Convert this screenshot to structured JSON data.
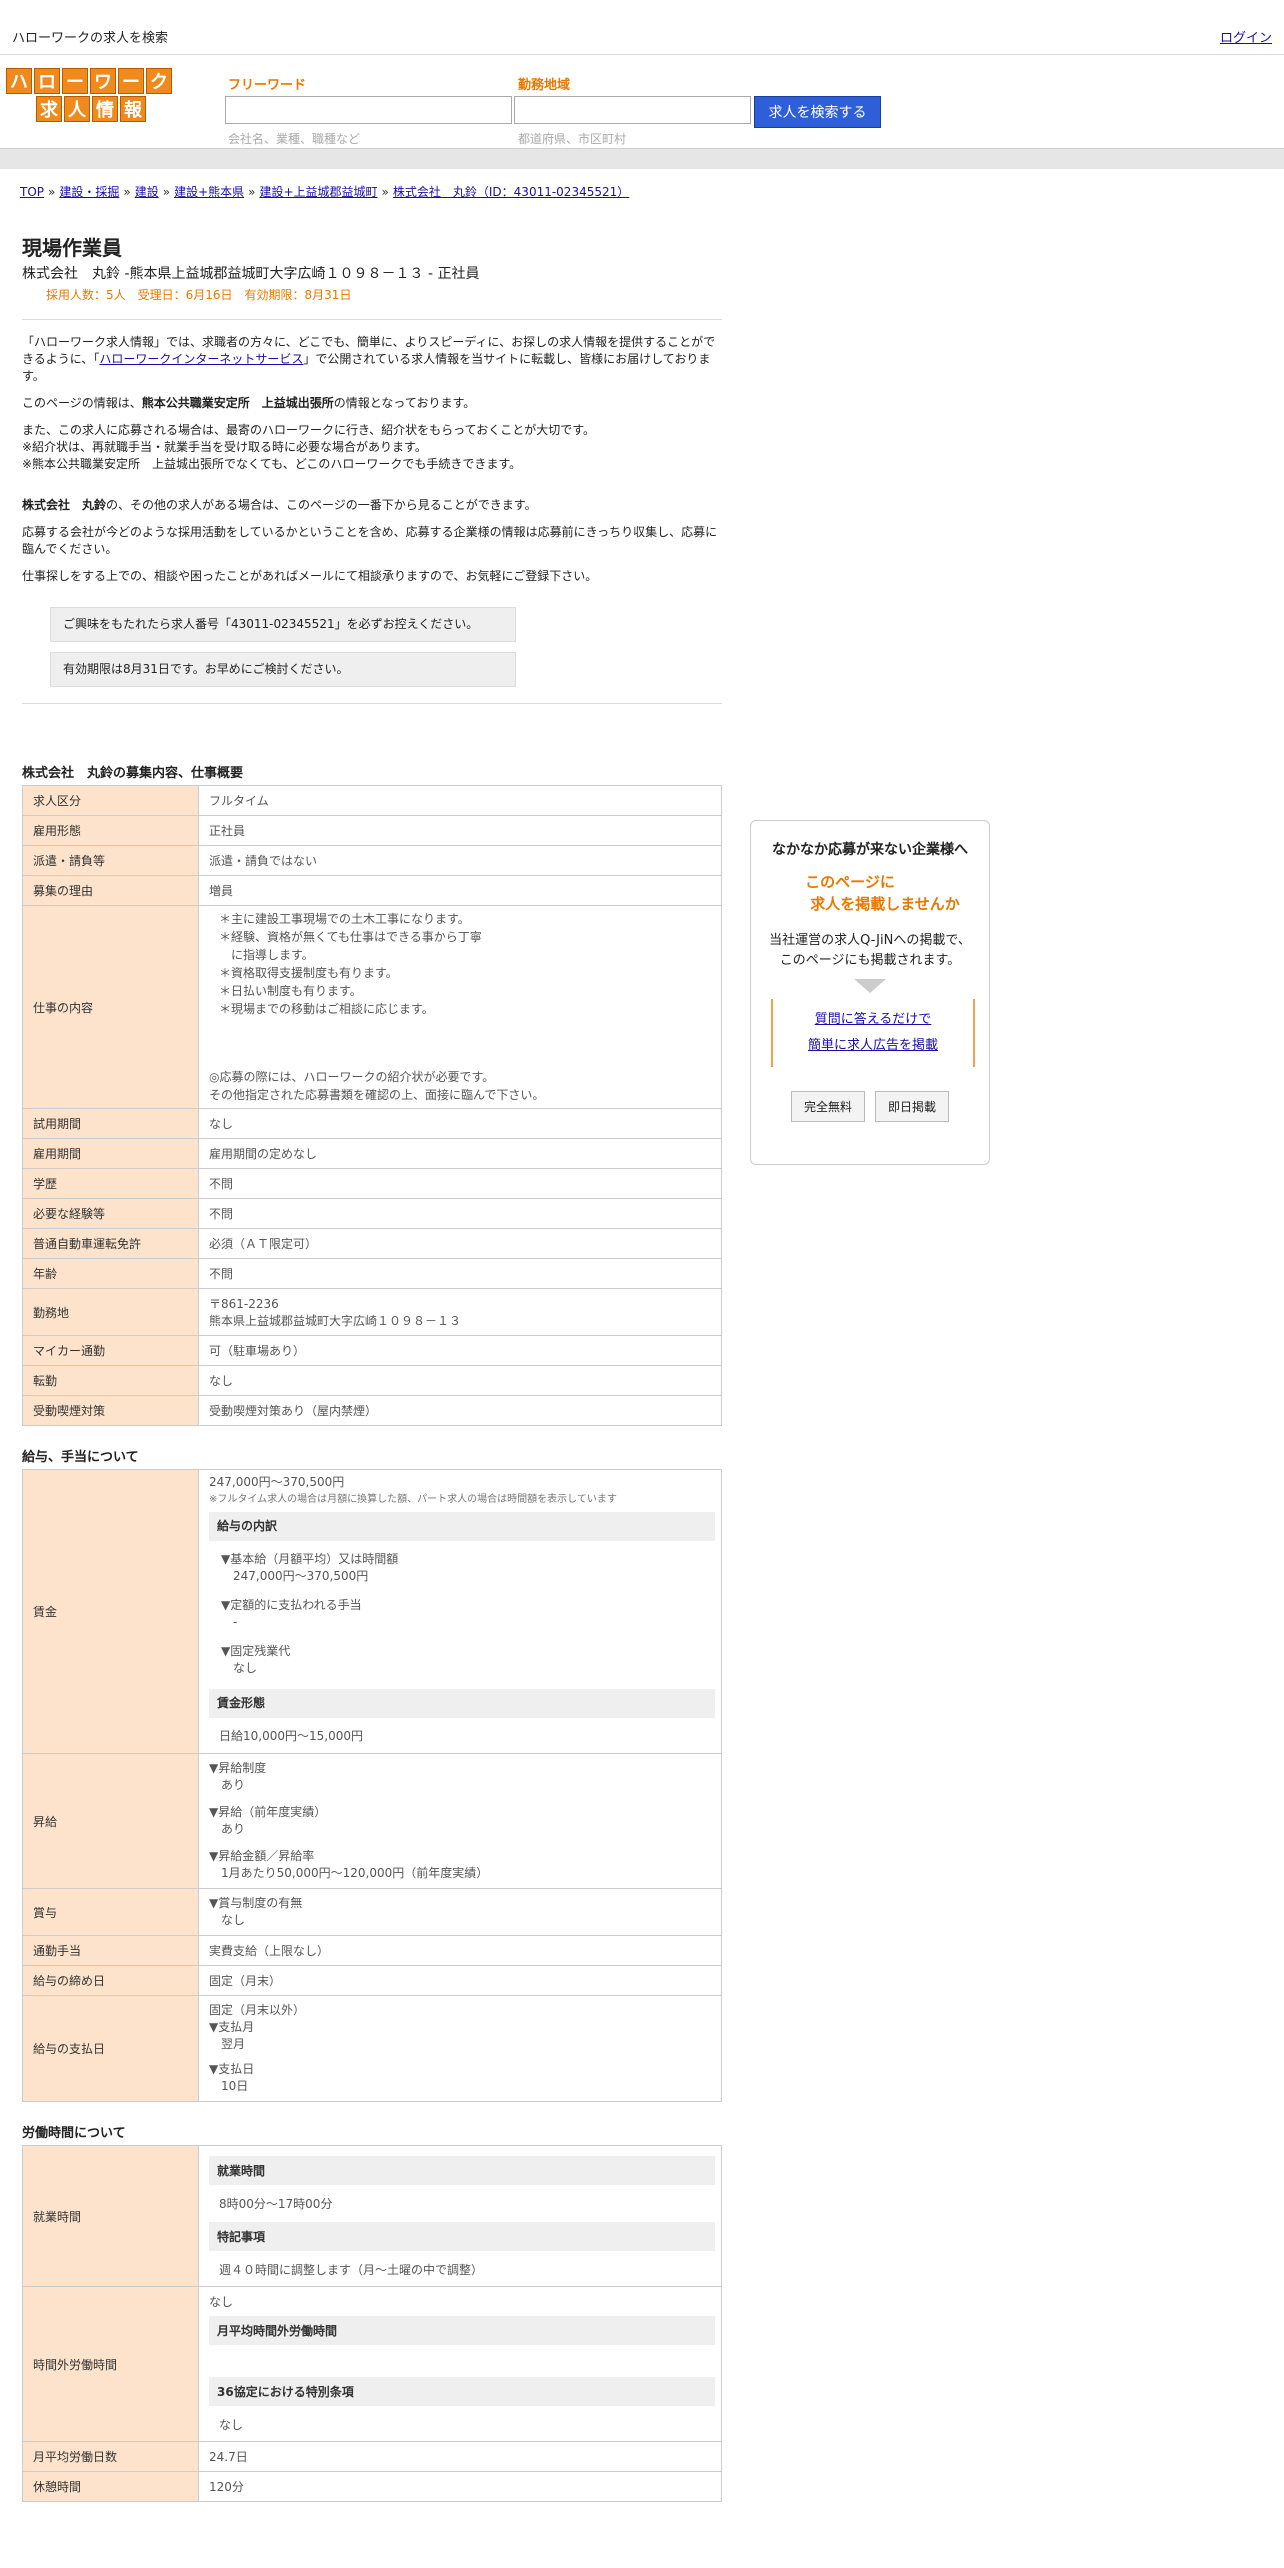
{
  "header": {
    "tagline": "ハローワークの求人を検索",
    "login": "ログイン"
  },
  "logo": {
    "row1": [
      "ハ",
      "ロ",
      "ー",
      "ワ",
      "ー",
      "ク"
    ],
    "row2": [
      "求",
      "人",
      "情",
      "報"
    ]
  },
  "search": {
    "freeword_label": "フリーワード",
    "freeword_hint": "会社名、業種、職種など",
    "area_label": "勤務地域",
    "area_hint": "都道府県、市区町村",
    "button": "求人を検索する"
  },
  "breadcrumb": [
    "TOP",
    "建設・採掘",
    "建設",
    "建設+熊本県",
    "建設+上益城郡益城町",
    "株式会社　丸鈴（ID：43011-02345521）"
  ],
  "job": {
    "title": "現場作業員",
    "subtitle": "株式会社　丸鈴 -熊本県上益城郡益城町大字広崎１０９８－１３ - 正社員",
    "meta": "採用人数：5人　受理日：6月16日　有効期限：8月31日"
  },
  "intro": {
    "p1a": "「ハローワーク求人情報」では、求職者の方々に、どこでも、簡単に、よりスピーディに、お探しの求人情報を提供することができるように、「",
    "p1link": "ハローワークインターネットサービス",
    "p1b": "」で公開されている求人情報を当サイトに転載し、皆様にお届けしております。",
    "p2a": "このページの情報は、",
    "p2b": "熊本公共職業安定所　上益城出張所",
    "p2c": "の情報となっております。",
    "p3": [
      "また、この求人に応募される場合は、最寄のハローワークに行き、紹介状をもらっておくことが大切です。",
      "※紹介状は、再就職手当・就業手当を受け取る時に必要な場合があります。",
      "※熊本公共職業安定所　上益城出張所でなくても、どこのハローワークでも手続きできます。"
    ],
    "p4a": "株式会社　丸鈴",
    "p4b": "の、その他の求人がある場合は、このページの一番下から見ることができます。",
    "p5": "応募する会社が今どのような採用活動をしているかということを含め、応募する企業様の情報は応募前にきっちり収集し、応募に臨んでください。",
    "p6": "仕事探しをする上での、相談や困ったことがあればメールにて相談承りますので、お気軽にご登録下さい。",
    "note1": "ご興味をもたれたら求人番号「43011-02345521」を必ずお控えください。",
    "note2": "有効期限は8月31日です。お早めにご検討ください。"
  },
  "s1": {
    "head": "株式会社　丸鈴の募集内容、仕事概要",
    "rows": [
      {
        "k": "求人区分",
        "v": "フルタイム"
      },
      {
        "k": "雇用形態",
        "v": "正社員"
      },
      {
        "k": "派遣・請負等",
        "v": "派遣・請負ではない"
      },
      {
        "k": "募集の理由",
        "v": "増員"
      }
    ],
    "work_k": "仕事の内容",
    "work_lines": [
      "＊主に建設工事現場での土木工事になります。",
      "＊経験、資格が無くても仕事はできる事から丁寧",
      "　に指導します。",
      "＊資格取得支援制度も有ります。",
      "＊日払い制度も有ります。",
      "＊現場までの移動はご相談に応じます。"
    ],
    "work_tail": [
      "◎応募の際には、ハローワークの紹介状が必要です。",
      "その他指定された応募書類を確認の上、面接に臨んで下さい。"
    ],
    "rows2": [
      {
        "k": "試用期間",
        "v": "なし"
      },
      {
        "k": "雇用期間",
        "v": "雇用期間の定めなし"
      },
      {
        "k": "学歴",
        "v": "不問"
      },
      {
        "k": "必要な経験等",
        "v": "不問"
      },
      {
        "k": "普通自動車運転免許",
        "v": "必須（ＡＴ限定可）"
      },
      {
        "k": "年齢",
        "v": "不問"
      }
    ],
    "loc_k": "勤務地",
    "loc_zip": "〒861-2236",
    "loc_addr": "熊本県上益城郡益城町大字広崎１０９８－１３",
    "rows3": [
      {
        "k": "マイカー通勤",
        "v": "可（駐車場あり）"
      },
      {
        "k": "転勤",
        "v": "なし"
      },
      {
        "k": "受動喫煙対策",
        "v": "受動喫煙対策あり（屋内禁煙）"
      }
    ]
  },
  "s2": {
    "head": "給与、手当について",
    "wage_k": "賃金",
    "wage_range": "247,000円〜370,500円",
    "wage_note": "※フルタイム求人の場合は月額に換算した額、パート求人の場合は時間額を表示しています",
    "breakdown": "給与の内訳",
    "basic_l": "▼基本給（月額平均）又は時間額",
    "basic_v": "247,000円〜370,500円",
    "fixed_l": "▼定額的に支払われる手当",
    "fixed_v": "-",
    "ot_l": "▼固定残業代",
    "ot_v": "なし",
    "form": "賃金形態",
    "form_v": "日給10,000円〜15,000円",
    "raise_k": "昇給",
    "raise": [
      {
        "l": "▼昇給制度",
        "v": "あり"
      },
      {
        "l": "▼昇給（前年度実績）",
        "v": "あり"
      },
      {
        "l": "▼昇給金額／昇給率",
        "v": "1月あたり50,000円〜120,000円（前年度実績）"
      }
    ],
    "bonus_k": "賞与",
    "bonus_l": "▼賞与制度の有無",
    "bonus_v": "なし",
    "commute_k": "通勤手当",
    "commute_v": "実費支給（上限なし）",
    "close_k": "給与の締め日",
    "close_v": "固定（月末）",
    "pay_k": "給与の支払日",
    "pay_v": "固定（月末以外）",
    "pay_m_l": "▼支払月",
    "pay_m_v": "翌月",
    "pay_d_l": "▼支払日",
    "pay_d_v": "10日"
  },
  "s3": {
    "head": "労働時間について",
    "hours_k": "就業時間",
    "hours_sub": "就業時間",
    "hours_v": "8時00分〜17時00分",
    "special_sub": "特記事項",
    "special_v": "週４０時間に調整します（月～土曜の中で調整）",
    "ot_k": "時間外労働時間",
    "ot_v": "なし",
    "ot_avg_sub": "月平均時間外労働時間",
    "ot_36_sub": "36協定における特別条項",
    "ot_36_v": "なし",
    "days_k": "月平均労働日数",
    "days_v": "24.7日",
    "rest_k": "休憩時間",
    "rest_v": "120分"
  },
  "side": {
    "heading": "なかなか応募が来ない企業様へ",
    "offer1": "このページに",
    "offer2": "求人を掲載しませんか",
    "desc1": "当社運営の求人Q-JiNへの掲載で、",
    "desc2": "このページにも掲載されます。",
    "link1": "質問に答えるだけで",
    "link2": "簡単に求人広告を掲載",
    "btn1": "完全無料",
    "btn2": "即日掲載"
  }
}
